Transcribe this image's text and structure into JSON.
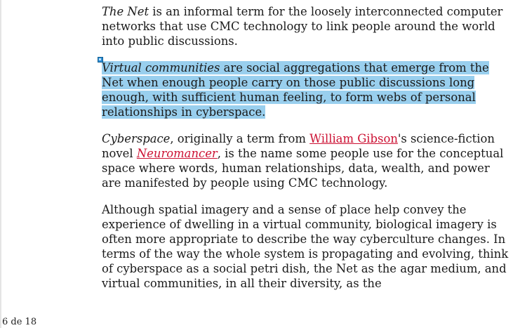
{
  "document": {
    "paragraphs": [
      {
        "term": "The Net",
        "text": " is an informal term for the loosely interconnected computer networks that use CMC technology to link people around the world into public discussions."
      },
      {
        "term": "Virtual communities",
        "text": " are social aggregations that emerge from the Net when enough people carry on those public discussions long enough, with sufficient human feeling, to form webs of personal relationships in cyberspace.",
        "selected": true
      },
      {
        "term": "Cyberspace",
        "text_1": ", originally a term from ",
        "link_1": "William Gibson",
        "text_2": "'s science-fiction novel ",
        "link_2": "Neuromancer",
        "text_3": ", is the name some people use for the conceptual space where words, human relationships, data, wealth, and power are manifested by people using CMC technology."
      },
      {
        "text": "Although spatial imagery and a sense of place help convey the experience of dwelling in a virtual community, biological imagery is often more appropriate to describe the way cyberculture changes. In terms of the way the whole system is propagating and evolving, think of cyberspace as a social petri dish, the Net as the agar medium, and virtual communities, in all their diversity, as the"
      }
    ],
    "page_indicator": "6 de 18"
  },
  "colors": {
    "selection": "#99cfee",
    "link": "#cc1133",
    "handle": "#2a8ad6"
  }
}
